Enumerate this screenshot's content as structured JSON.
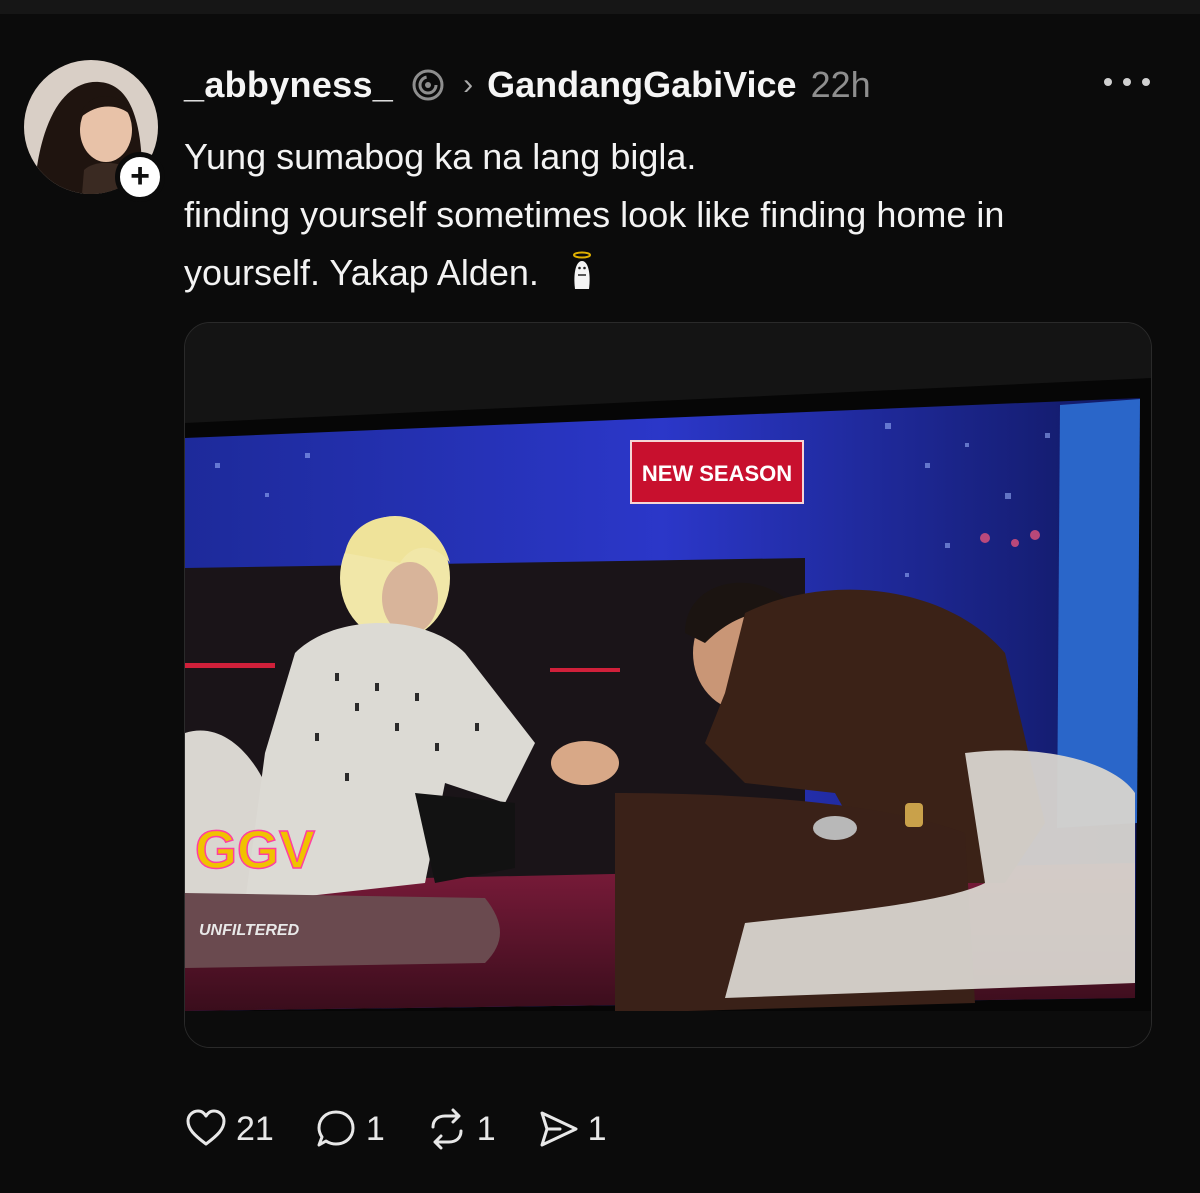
{
  "post": {
    "username": "_abbyness_",
    "community": "GandangGabiVice",
    "time": "22h",
    "lines": [
      "Yung sumabog ka na lang bigla.",
      "finding yourself sometimes look like finding home in",
      "yourself. Yakap Alden."
    ],
    "follow_symbol": "+"
  },
  "media": {
    "sign_text": "NEW SEASON",
    "logo_text": "GGV",
    "logo_sub": "UNFILTERED"
  },
  "actions": {
    "likes": "21",
    "replies": "1",
    "reposts": "1",
    "shares": "1"
  },
  "icons": [
    "threads-icon",
    "chevron-right-icon",
    "more-icon",
    "angel-emoji-icon",
    "heart-icon",
    "comment-icon",
    "repost-icon",
    "share-icon"
  ],
  "colors": {
    "background": "#0b0b0b",
    "text": "#f3f3f3",
    "muted": "#8e8e8e",
    "sign_red": "#c8102e"
  }
}
